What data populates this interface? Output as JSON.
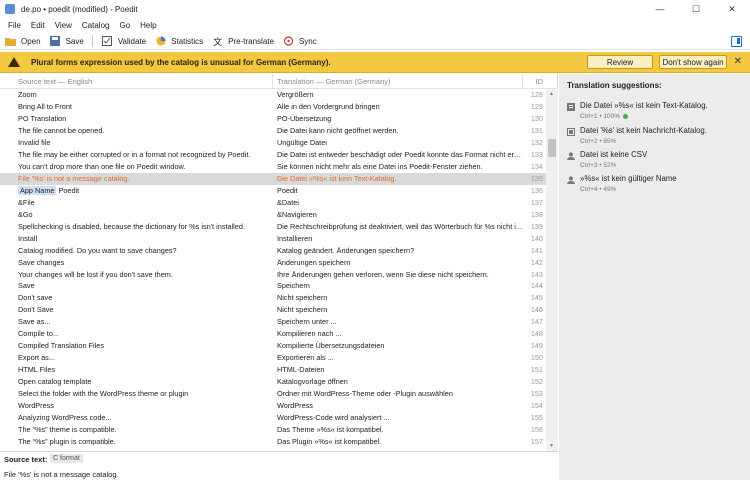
{
  "window": {
    "title": "de.po • poedit (modified) - Poedit"
  },
  "menu": [
    "File",
    "Edit",
    "View",
    "Catalog",
    "Go",
    "Help"
  ],
  "toolbar": {
    "open": "Open",
    "save": "Save",
    "validate": "Validate",
    "statistics": "Statistics",
    "pretranslate": "Pre-translate",
    "sync": "Sync"
  },
  "warning": {
    "text": "Plural forms expression used by the catalog is unusual for German (Germany).",
    "review": "Review",
    "dont_show": "Don't show again"
  },
  "list": {
    "header_source": "Source text — English",
    "header_translation": "Translation — German (Germany)",
    "header_id": "ID",
    "rows": [
      {
        "s": "Zoom",
        "t": "Vergrößern",
        "id": "128"
      },
      {
        "s": "Bring All to Front",
        "t": "Alle in den Vordergrund bringen",
        "id": "129"
      },
      {
        "s": "PO Translation",
        "t": "PO-Übersetzung",
        "id": "130"
      },
      {
        "s": "The file cannot be opened.",
        "t": "Die Datei kann nicht geöffnet werden.",
        "id": "131"
      },
      {
        "s": "Invalid file",
        "t": "Ungültige Datei",
        "id": "132"
      },
      {
        "s": "The file may be either corrupted or in a format not recognized by Poedit.",
        "t": "Die Datei ist entweder beschädigt oder Poedit konnte das Format nicht erk...",
        "id": "133"
      },
      {
        "s": "You can't drop more than one file on Poedit window.",
        "t": "Sie können nicht mehr als eine Datei ins Poedit-Fenster ziehen.",
        "id": "134"
      },
      {
        "s": "File '%s' is not a message catalog.",
        "t": "Die Datei »%s« ist kein Text-Katalog.",
        "id": "135"
      },
      {
        "s": "Poedit",
        "tag": "App Name",
        "t": "Poedit",
        "id": "136"
      },
      {
        "s": "&File",
        "t": "&Datei",
        "id": "137"
      },
      {
        "s": "&Go",
        "t": "&Navigieren",
        "id": "138"
      },
      {
        "s": "Spellchecking is disabled, because the dictionary for %s isn't installed.",
        "t": "Die Rechtschreibprüfung ist deaktiviert, weil das Wörterbuch für %s nicht i...",
        "id": "139"
      },
      {
        "s": "Install",
        "t": "Installieren",
        "id": "140"
      },
      {
        "s": "Catalog modified. Do you want to save changes?",
        "t": "Katalog geändert. Änderungen speichern?",
        "id": "141"
      },
      {
        "s": "Save changes",
        "t": "Änderungen speichern",
        "id": "142"
      },
      {
        "s": "Your changes will be lost if you don't save them.",
        "t": "Ihre Änderungen gehen verloren, wenn Sie diese nicht speichern.",
        "id": "143"
      },
      {
        "s": "Save",
        "t": "Speichern",
        "id": "144"
      },
      {
        "s": "Don't save",
        "t": "Nicht speichern",
        "id": "145"
      },
      {
        "s": "Don't Save",
        "t": "Nicht speichern",
        "id": "146"
      },
      {
        "s": "Save as...",
        "t": "Speichern unter ...",
        "id": "147"
      },
      {
        "s": "Compile to...",
        "t": "Kompilieren nach ...",
        "id": "148"
      },
      {
        "s": "Compiled Translation Files",
        "t": "Kompilierte Übersetzungsdateien",
        "id": "149"
      },
      {
        "s": "Export as...",
        "t": "Exportieren als ...",
        "id": "150"
      },
      {
        "s": "HTML Files",
        "t": "HTML-Dateien",
        "id": "151"
      },
      {
        "s": "Open catalog template",
        "t": "Katalogvorlage öffnen",
        "id": "152"
      },
      {
        "s": "Select the folder with the WordPress theme or plugin",
        "t": "Ordner mit WordPress-Theme oder -Plugin auswählen",
        "id": "153"
      },
      {
        "s": "WordPress",
        "t": "WordPress",
        "id": "154"
      },
      {
        "s": "Analyzing WordPress code...",
        "t": "WordPress-Code wird analysiert ...",
        "id": "155"
      },
      {
        "s": "The “%s” theme is compatible.",
        "t": "Das Theme »%s« ist kompatibel.",
        "id": "156"
      },
      {
        "s": "The “%s” plugin is compatible.",
        "t": "Das Plugin »%s« ist kompatibel.",
        "id": "157"
      }
    ]
  },
  "selected_index": 7,
  "editor": {
    "label": "Source text:",
    "format": "C format",
    "source": "File '%s' is not a message catalog."
  },
  "sidebar": {
    "title": "Translation suggestions:",
    "items": [
      {
        "text": "Die Datei »%s« ist kein Text-Katalog.",
        "meta": "Ctrl+1 • 100%",
        "icon": "tm-icon"
      },
      {
        "text": "Datei '%s' ist kein Nachricht-Katalog.",
        "meta": "Ctrl+2 • 85%",
        "icon": "machine-icon"
      },
      {
        "text": "Datei ist keine CSV",
        "meta": "Ctrl+3 • 52%",
        "icon": "user-icon"
      },
      {
        "text": "»%s« ist kein gültiger Name",
        "meta": "Ctrl+4 • 49%",
        "icon": "user-icon"
      }
    ]
  },
  "colors": {
    "warning": "#f5c842",
    "selected_text": "#e06c2a",
    "accent": "#1a6fc9"
  }
}
